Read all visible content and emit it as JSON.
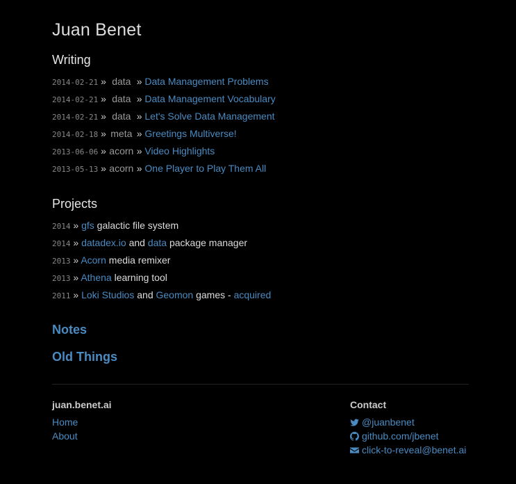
{
  "site": {
    "title": "Juan Benet"
  },
  "writing": {
    "heading": "Writing",
    "posts": [
      {
        "date": "2014-02-21",
        "category": "data",
        "title": "Data Management Problems"
      },
      {
        "date": "2014-02-21",
        "category": "data",
        "title": "Data Management Vocabulary"
      },
      {
        "date": "2014-02-21",
        "category": "data",
        "title": "Let's Solve Data Management"
      },
      {
        "date": "2014-02-18",
        "category": "meta",
        "title": "Greetings Multiverse!"
      },
      {
        "date": "2013-06-06",
        "category": "acorn",
        "title": "Video Highlights"
      },
      {
        "date": "2013-05-13",
        "category": "acorn",
        "title": "One Player to Play Them All"
      }
    ]
  },
  "projects": {
    "heading": "Projects",
    "items": [
      {
        "year": "2014",
        "link1": "gfs",
        "text1": "galactic file system"
      },
      {
        "year": "2014",
        "link1": "datadex.io",
        "text1": "and",
        "link2": "data",
        "text2": "package manager"
      },
      {
        "year": "2013",
        "link1": "Acorn",
        "text1": "media remixer"
      },
      {
        "year": "2013",
        "link1": "Athena",
        "text1": "learning tool"
      },
      {
        "year": "2011",
        "link1": "Loki Studios",
        "text1": "and",
        "link2": "Geomon",
        "text2": "games -",
        "link3": "acquired"
      }
    ]
  },
  "separator": "»",
  "links": {
    "notes": "Notes",
    "old_things": "Old Things"
  },
  "footer": {
    "site_name": "juan.benet.ai",
    "nav": {
      "home": "Home",
      "about": "About"
    },
    "contact": {
      "heading": "Contact",
      "twitter": "@juanbenet",
      "github": "github.com/jbenet",
      "email": "click-to-reveal@benet.ai"
    }
  },
  "colors": {
    "background": "#000000",
    "link": "#4a8bc2",
    "text": "#dddddd",
    "muted": "#888888"
  },
  "icons": {
    "twitter": "twitter-icon",
    "github": "github-icon",
    "email": "envelope-icon"
  }
}
